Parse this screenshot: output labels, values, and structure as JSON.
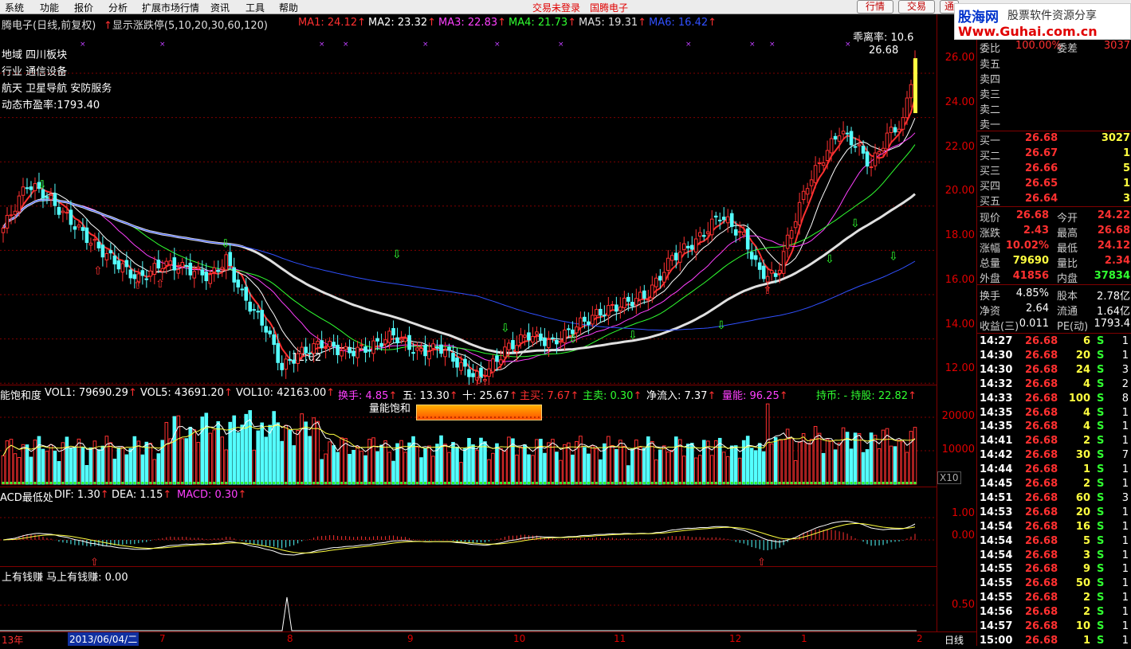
{
  "menu": {
    "items": [
      "系统",
      "功能",
      "报价",
      "分析",
      "扩展市场行情",
      "资讯",
      "工具",
      "帮助"
    ],
    "trade_status": "交易未登录",
    "stock_link": "国腾电子",
    "btn_quote": "行情",
    "btn_trade": "交易",
    "btn_more": "通"
  },
  "logo": {
    "cn": "股海网",
    "tag": "股票软件资源分享",
    "url": "Www.Guhai.com.cn"
  },
  "main": {
    "title": "腾电子(日线,前复权)",
    "indicator": "显示涨跌停(5,10,20,30,60,120)",
    "ma": [
      {
        "label": "MA1: 24.12",
        "color": "#ff3030"
      },
      {
        "label": "MA2: 23.32",
        "color": "#ffffff"
      },
      {
        "label": "MA3: 22.83",
        "color": "#ff40ff"
      },
      {
        "label": "MA4: 21.73",
        "color": "#30ff30"
      },
      {
        "label": "MA5: 19.31",
        "color": "#e0e0e0"
      },
      {
        "label": "MA6: 16.42",
        "color": "#3050ff"
      }
    ],
    "info": [
      "地域 四川板块",
      "行业 通信设备",
      "航天 卫星导航 安防服务",
      "动态市盈率:1793.40"
    ],
    "bias": "乖离率: 10.6",
    "last_price": "26.68",
    "low_label": "12.02",
    "yticks": [
      "26.00",
      "24.00",
      "22.00",
      "20.00",
      "18.00",
      "16.00",
      "14.00",
      "12.00"
    ]
  },
  "vol": {
    "header": [
      {
        "t": "能饱和度",
        "c": "#ffffff"
      },
      {
        "t": "VOL1: 79690.29",
        "c": "#ffffff"
      },
      {
        "t": "VOL5: 43691.20",
        "c": "#ffffff"
      },
      {
        "t": "VOL10: 42163.00",
        "c": "#ffffff"
      },
      {
        "t": "换手: 4.85",
        "c": "#ff40ff"
      },
      {
        "t": "五: 13.30",
        "c": "#ffffff"
      },
      {
        "t": "十: 25.67",
        "c": "#ffffff"
      },
      {
        "t": "主买: 7.67",
        "c": "#ff3030"
      },
      {
        "t": "主卖: 0.30",
        "c": "#30ff30"
      },
      {
        "t": "净流入: 7.37",
        "c": "#ffffff"
      },
      {
        "t": "量能: 96.25",
        "c": "#ff40ff"
      },
      {
        "t": "持币: - 持股: 22.82",
        "c": "#30ff30"
      }
    ],
    "saturation_label": "量能饱和",
    "yticks": [
      "20000",
      "10000"
    ],
    "unit": "X10"
  },
  "macd": {
    "header": [
      {
        "t": "ACD最低处",
        "c": "#ffffff"
      },
      {
        "t": "DIF: 1.30",
        "c": "#ffffff"
      },
      {
        "t": "DEA: 1.15",
        "c": "#ffffff"
      },
      {
        "t": "MACD: 0.30",
        "c": "#ff40ff"
      }
    ],
    "yticks": [
      "1.00",
      "0.00"
    ]
  },
  "earn": {
    "header": "上有钱赚  马上有钱赚: 0.00",
    "yticks": [
      "0.50"
    ]
  },
  "bottom": {
    "year": "13年",
    "date": "2013/06/04/二",
    "months": [
      "7",
      "8",
      "9",
      "10",
      "11",
      "12",
      "1",
      "2"
    ],
    "period": "日线"
  },
  "panel": {
    "ratio_label": "委比",
    "ratio_val": "100.00%",
    "diff_label": "委差",
    "diff_val": "3037",
    "sells": [
      "卖五",
      "卖四",
      "卖三",
      "卖二",
      "卖一"
    ],
    "buys": [
      {
        "l": "买一",
        "p": "26.68",
        "v": "3027"
      },
      {
        "l": "买二",
        "p": "26.67",
        "v": "1"
      },
      {
        "l": "买三",
        "p": "26.66",
        "v": "5"
      },
      {
        "l": "买四",
        "p": "26.65",
        "v": "1"
      },
      {
        "l": "买五",
        "p": "26.64",
        "v": "3"
      }
    ],
    "stats": [
      {
        "l1": "现价",
        "v1": "26.68",
        "c1": "#ff3030",
        "l2": "今开",
        "v2": "24.22",
        "c2": "#ff3030"
      },
      {
        "l1": "涨跌",
        "v1": "2.43",
        "c1": "#ff3030",
        "l2": "最高",
        "v2": "26.68",
        "c2": "#ff3030"
      },
      {
        "l1": "涨幅",
        "v1": "10.02%",
        "c1": "#ff3030",
        "l2": "最低",
        "v2": "24.12",
        "c2": "#ff3030"
      },
      {
        "l1": "总量",
        "v1": "79690",
        "c1": "#ffff40",
        "l2": "量比",
        "v2": "2.34",
        "c2": "#ff3030"
      },
      {
        "l1": "外盘",
        "v1": "41856",
        "c1": "#ff3030",
        "l2": "内盘",
        "v2": "37834",
        "c2": "#30ff30"
      }
    ],
    "stats2": [
      {
        "l1": "换手",
        "v1": "4.85%",
        "l2": "股本",
        "v2": "2.78亿"
      },
      {
        "l1": "净资",
        "v1": "2.64",
        "l2": "流通",
        "v2": "1.64亿"
      },
      {
        "l1": "收益(三)",
        "v1": "0.011",
        "l2": "PE(动)",
        "v2": "1793.4"
      }
    ],
    "ticks": [
      [
        "14:27",
        "26.68",
        "6",
        "S",
        "1"
      ],
      [
        "14:30",
        "26.68",
        "20",
        "S",
        "1"
      ],
      [
        "14:30",
        "26.68",
        "24",
        "S",
        "3"
      ],
      [
        "14:32",
        "26.68",
        "4",
        "S",
        "2"
      ],
      [
        "14:33",
        "26.68",
        "100",
        "S",
        "8"
      ],
      [
        "14:35",
        "26.68",
        "4",
        "S",
        "1"
      ],
      [
        "14:35",
        "26.68",
        "4",
        "S",
        "1"
      ],
      [
        "14:41",
        "26.68",
        "2",
        "S",
        "1"
      ],
      [
        "14:42",
        "26.68",
        "30",
        "S",
        "7"
      ],
      [
        "14:44",
        "26.68",
        "1",
        "S",
        "1"
      ],
      [
        "14:45",
        "26.68",
        "2",
        "S",
        "1"
      ],
      [
        "14:51",
        "26.68",
        "60",
        "S",
        "3"
      ],
      [
        "14:53",
        "26.68",
        "20",
        "S",
        "1"
      ],
      [
        "14:54",
        "26.68",
        "16",
        "S",
        "1"
      ],
      [
        "14:54",
        "26.68",
        "5",
        "S",
        "1"
      ],
      [
        "14:54",
        "26.68",
        "3",
        "S",
        "1"
      ],
      [
        "14:55",
        "26.68",
        "9",
        "S",
        "1"
      ],
      [
        "14:55",
        "26.68",
        "50",
        "S",
        "1"
      ],
      [
        "14:55",
        "26.68",
        "2",
        "S",
        "1"
      ],
      [
        "14:56",
        "26.68",
        "2",
        "S",
        "1"
      ],
      [
        "14:57",
        "26.68",
        "10",
        "S",
        "1"
      ],
      [
        "15:00",
        "26.68",
        "1",
        "S",
        "1"
      ]
    ]
  },
  "colors": {
    "up": "#ff3030",
    "down": "#54ffff",
    "grid": "#800000"
  }
}
